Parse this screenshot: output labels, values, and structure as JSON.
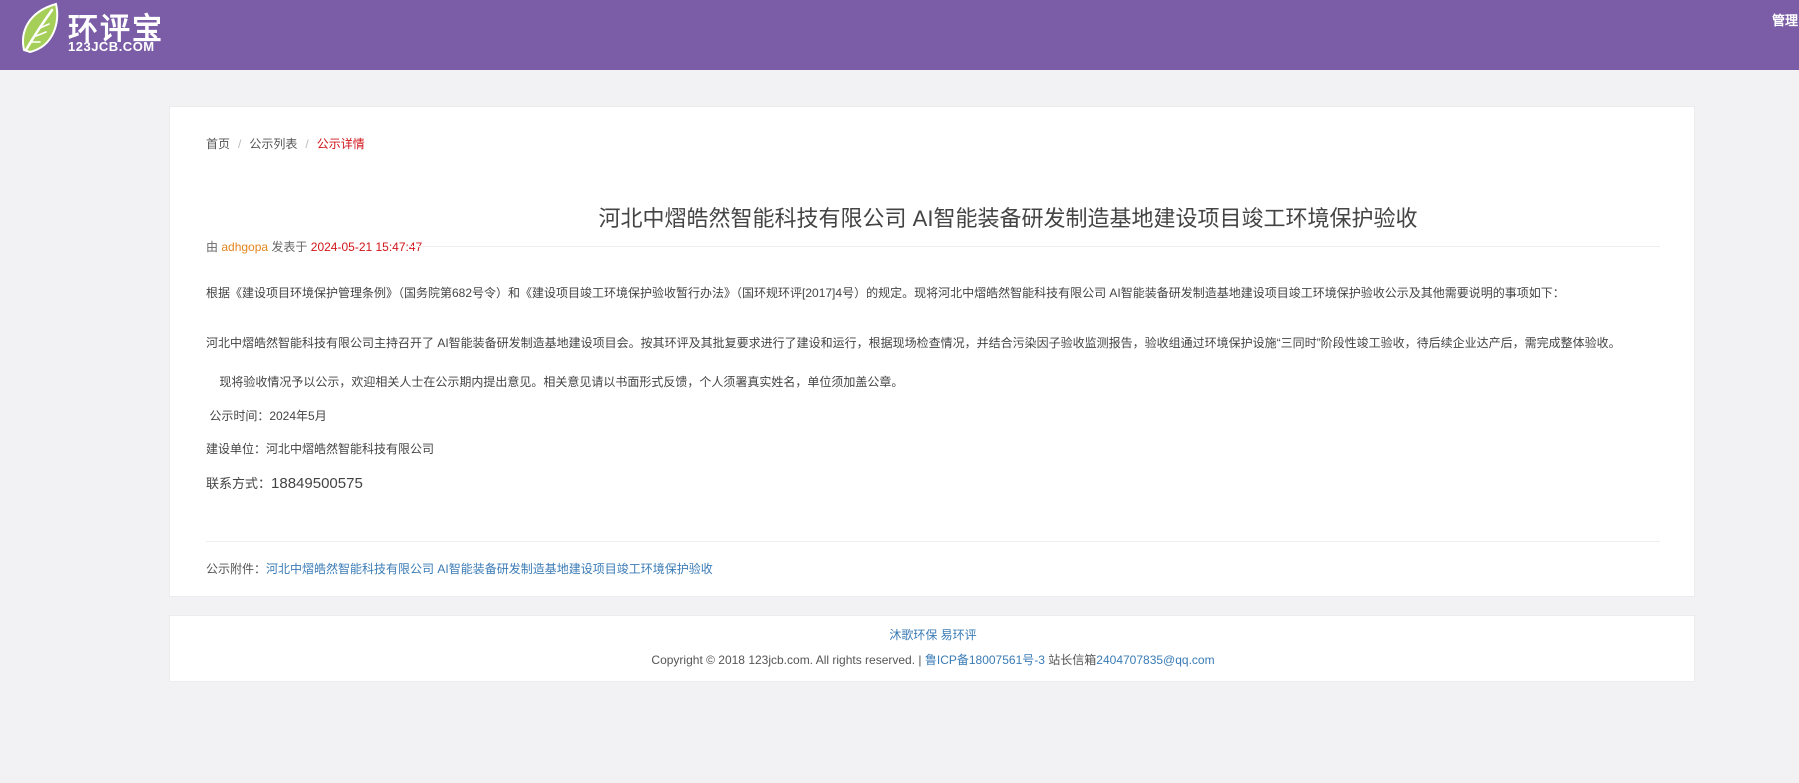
{
  "header": {
    "logo_title": "环评宝",
    "logo_sub": "123JCB.COM",
    "admin_link": "管理中心",
    "brand_color": "#7a5da6"
  },
  "breadcrumb": {
    "home": "首页",
    "list": "公示列表",
    "current": "公示详情"
  },
  "article": {
    "title": "河北中熠皓然智能科技有限公司 AI智能装备研发制造基地建设项目竣工环境保护验收",
    "meta_prefix": "由",
    "author": "adhgopa",
    "meta_mid": "发表于",
    "date": "2024-05-21 15:47:47",
    "paragraphs": [
      "根据《建设项目环境保护管理条例》（国务院第682号令）和《建设项目竣工环境保护验收暂行办法》（国环规环评[2017]4号）的规定。现将河北中熠皓然智能科技有限公司 AI智能装备研发制造基地建设项目竣工环境保护验收公示及其他需要说明的事项如下：",
      "河北中熠皓然智能科技有限公司主持召开了 AI智能装备研发制造基地建设项目会。按其环评及其批复要求进行了建设和运行，根据现场检查情况，并结合污染因子验收监测报告，验收组通过环境保护设施“三同时”阶段性竣工验收，待后续企业达产后，需完成整体验收。",
      "    现将验收情况予以公示，欢迎相关人士在公示期内提出意见。相关意见请以书面形式反馈，个人须署真实姓名，单位须加盖公章。",
      " 公示时间：2024年5月",
      "建设单位：河北中熠皓然智能科技有限公司"
    ],
    "contact_label": "联系方式：",
    "contact_value": "18849500575",
    "attachment_label": "公示附件：",
    "attachment_link": "河北中熠皓然智能科技有限公司 AI智能装备研发制造基地建设项目竣工环境保护验收"
  },
  "footer": {
    "links": "沐歌环保 易环评",
    "copyright": "Copyright © 2018 123jcb.com. All rights reserved. |",
    "icp": "鲁ICP备18007561号-3",
    "mail_label": "站长信箱",
    "mail": "2404707835@qq.com"
  }
}
